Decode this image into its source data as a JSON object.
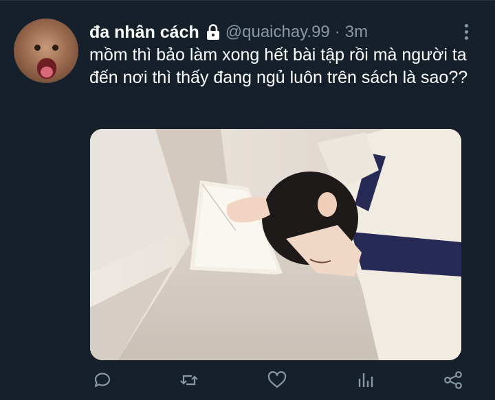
{
  "tweet": {
    "display_name": "đa nhân cách",
    "handle": "@quaichay.99",
    "separator": "·",
    "timestamp": "3m",
    "text": "mồm thì bảo làm xong hết bài tập rồi mà người ta đến nơi thì thấy đang ngủ luôn trên sách là sao??"
  },
  "media": {
    "alt": ""
  },
  "actions": [
    {
      "icon": "reply-icon"
    },
    {
      "icon": "retweet-icon"
    },
    {
      "icon": "like-icon"
    },
    {
      "icon": "analytics-icon"
    },
    {
      "icon": "share-icon"
    }
  ],
  "colors": {
    "background": "#15202b",
    "secondary_text": "#8899a6",
    "icon": "#8899a6"
  }
}
